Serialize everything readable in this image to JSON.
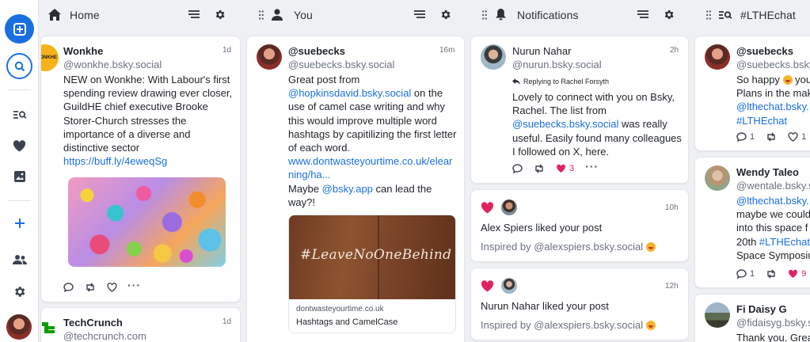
{
  "rail": {
    "items": [
      "compose-icon",
      "search-icon",
      "feeds-icon",
      "likes-icon",
      "media-icon",
      "add-icon",
      "people-icon",
      "gear-icon"
    ]
  },
  "columns": [
    {
      "title": "Home",
      "icon": "home-icon"
    },
    {
      "title": "You",
      "icon": "person-icon"
    },
    {
      "title": "Notifications",
      "icon": "bell-icon"
    },
    {
      "title": "#LTHEchat",
      "icon": "feed-search-icon"
    }
  ],
  "home": {
    "post1": {
      "name": "Wonkhe",
      "handle": "@wonkhe.bsky.social",
      "time": "1d",
      "avatar_text": "WONKHE",
      "text": "NEW on Wonkhe: With Labour's first spending review drawing ever closer, GuildHE chief executive Brooke Storer-Church stresses the importance of a diverse and distinctive sector ",
      "link": "https://buff.ly/4eweqSg"
    },
    "post2": {
      "name": "TechCrunch",
      "handle": "@techcrunch.com",
      "time": "1d"
    }
  },
  "you": {
    "post": {
      "name": "@suebecks",
      "handle": "@suebecks.bsky.social",
      "time": "16m",
      "t1": "Great post from ",
      "l1": "@hopkinsdavid.bsky.social",
      "t2": " on the use of camel case writing and why this would improve multiple word hashtags by capitilizing the first letter of each word.",
      "l2": "www.dontwasteyourtime.co.uk/elearning/ha...",
      "t3": "Maybe ",
      "l3": "@bsky.app",
      "t4": " can lead the way?!",
      "embed_img_text": "#LeaveNoOneBehind",
      "embed_domain": "dontwasteyourtime.co.uk",
      "embed_title": "Hashtags and CamelCase"
    }
  },
  "notifications": {
    "reply": {
      "name": "Nurun Nahar",
      "handle": "@nurun.bsky.social",
      "time": "2h",
      "replying": "Replying to Rachel Forsyth",
      "t1": "Lovely to connect with you on Bsky, Rachel. The list from ",
      "l1": "@suebecks.bsky.social",
      "t2": " was really useful. Easily found many colleagues I followed on X, here.",
      "likes": "3"
    },
    "like1": {
      "name": "Alex Spiers",
      "action": " liked your post",
      "time": "10h",
      "sub": "Inspired by @alexspiers.bsky.social "
    },
    "like2": {
      "name": "Nurun Nahar",
      "action": " liked your post",
      "time": "12h",
      "sub": "Inspired by @alexspiers.bsky.social "
    }
  },
  "lthe": {
    "post1": {
      "name": "@suebecks",
      "handle": "@suebecks.bsky",
      "t1": "So happy ",
      "t1b": " you",
      "t2": "Plans in the mak",
      "l1": "@lthechat.bsky.",
      "l2": "#LTHEchat",
      "replies": "1",
      "likes": "1"
    },
    "post2": {
      "name": "Wendy Taleo",
      "handle": "@wentale.bsky.s",
      "l1": "@lthechat.bsky.",
      "t1": "maybe we could",
      "t2": "into this space f",
      "t3": "20th ",
      "l2": "#LTHEchat",
      "t4": "Space Symposiu",
      "replies": "1",
      "likes": "9"
    },
    "post3": {
      "name": "Fi Daisy G",
      "handle": "@fidaisyg.bsky.s",
      "t1": "Thank you. Grea"
    }
  },
  "colors": {
    "accent": "#1a6fe0",
    "like": "#e0245e"
  }
}
